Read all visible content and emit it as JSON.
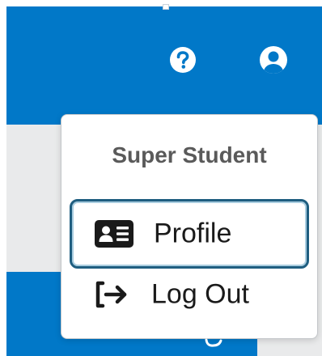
{
  "header": {
    "help_icon": "question-circle-icon",
    "account_icon": "user-circle-icon"
  },
  "colors": {
    "brand_blue": "#0178c8",
    "menu_title": "#5a5a5a",
    "focus_ring": "#1f5e80"
  },
  "menu": {
    "title": "Super Student",
    "items": [
      {
        "label": "Profile",
        "icon": "id-card-icon",
        "focused": true
      },
      {
        "label": "Log Out",
        "icon": "logout-arrow-icon",
        "focused": false
      }
    ]
  }
}
